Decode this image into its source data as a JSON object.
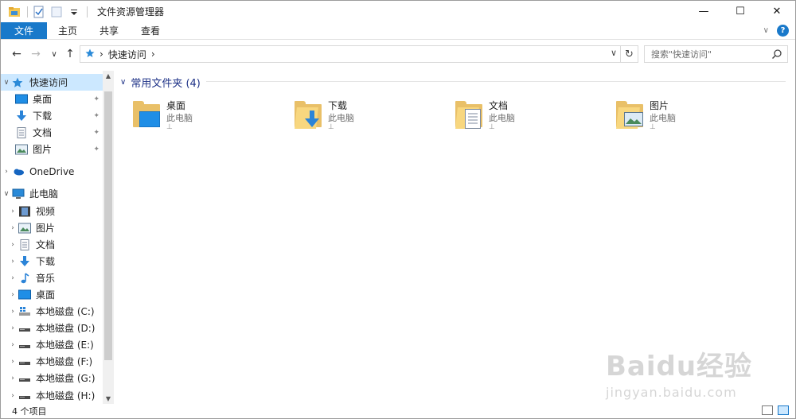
{
  "window": {
    "title": "文件资源管理器"
  },
  "titlebar": {
    "minimize_glyph": "—",
    "maximize_glyph": "☐",
    "close_glyph": "✕"
  },
  "ribbon": {
    "tabs": [
      {
        "label": "文件",
        "active": true
      },
      {
        "label": "主页"
      },
      {
        "label": "共享"
      },
      {
        "label": "查看"
      }
    ],
    "help_glyph": "?",
    "expand_glyph": "∨"
  },
  "address": {
    "back_glyph": "←",
    "forward_glyph": "→",
    "recent_glyph": "∨",
    "up_glyph": "↑",
    "crumb_sep": "›",
    "location": "快速访问",
    "dropdown_glyph": "∨",
    "refresh_glyph": "↻"
  },
  "search": {
    "placeholder": "搜索\"快速访问\""
  },
  "nav": {
    "quick_access": {
      "label": "快速访问",
      "expanded": true
    },
    "quick_items": [
      {
        "label": "桌面",
        "icon": "desktop-icon"
      },
      {
        "label": "下载",
        "icon": "download-icon"
      },
      {
        "label": "文档",
        "icon": "documents-icon"
      },
      {
        "label": "图片",
        "icon": "pictures-icon"
      }
    ],
    "onedrive": {
      "label": "OneDrive"
    },
    "this_pc": {
      "label": "此电脑"
    },
    "pc_items": [
      {
        "label": "视频",
        "icon": "videos-icon"
      },
      {
        "label": "图片",
        "icon": "pictures-icon"
      },
      {
        "label": "文档",
        "icon": "documents-icon"
      },
      {
        "label": "下载",
        "icon": "download-icon"
      },
      {
        "label": "音乐",
        "icon": "music-icon"
      },
      {
        "label": "桌面",
        "icon": "desktop-icon"
      },
      {
        "label": "本地磁盘 (C:)",
        "icon": "windows-drive-icon"
      },
      {
        "label": "本地磁盘 (D:)",
        "icon": "drive-icon"
      },
      {
        "label": "本地磁盘 (E:)",
        "icon": "drive-icon"
      },
      {
        "label": "本地磁盘 (F:)",
        "icon": "drive-icon"
      },
      {
        "label": "本地磁盘 (G:)",
        "icon": "drive-icon"
      },
      {
        "label": "本地磁盘 (H:)",
        "icon": "drive-icon"
      }
    ],
    "pin_glyph": "📌",
    "scroll_up_glyph": "▲",
    "scroll_down_glyph": "▼"
  },
  "content": {
    "group_title": "常用文件夹 (4)",
    "group_caret": "∨",
    "folders": [
      {
        "name": "桌面",
        "location": "此电脑",
        "overlay": "desktop"
      },
      {
        "name": "下载",
        "location": "此电脑",
        "overlay": "download"
      },
      {
        "name": "文档",
        "location": "此电脑",
        "overlay": "documents"
      },
      {
        "name": "图片",
        "location": "此电脑",
        "overlay": "pictures"
      }
    ],
    "pin_glyph": "⊥"
  },
  "status": {
    "item_count": "4 个项目"
  },
  "watermark": {
    "brand": "Baidu经验",
    "url": "jingyan.baidu.com"
  },
  "colors": {
    "accent": "#1979ca",
    "selection": "#cce8ff",
    "folder": "#f8d77f",
    "group_title": "#1e3287"
  }
}
